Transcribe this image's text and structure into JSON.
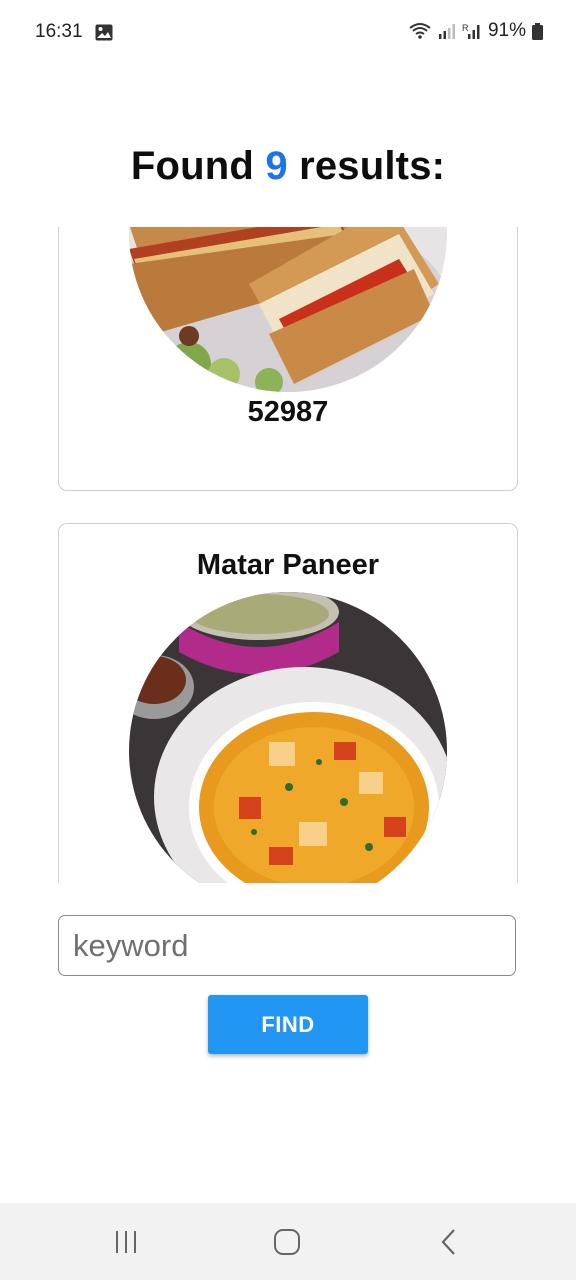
{
  "status_bar": {
    "time": "16:31",
    "battery": "91%",
    "icons": [
      "gallery-icon",
      "wifi-icon",
      "signal-icon",
      "signal-r-icon",
      "battery-icon"
    ]
  },
  "header": {
    "prefix": "Found ",
    "count": "9",
    "suffix": " results:"
  },
  "results": [
    {
      "title": "52987",
      "image": "grilled-sandwich-image"
    },
    {
      "title": "Matar Paneer",
      "image": "matar-paneer-curry-image"
    }
  ],
  "search": {
    "placeholder": "keyword",
    "value": "",
    "button_label": "FIND"
  },
  "nav": {
    "items": [
      "recents-icon",
      "home-icon",
      "back-icon"
    ]
  },
  "colors": {
    "accent": "#1e73e8",
    "button": "#2196f3"
  }
}
